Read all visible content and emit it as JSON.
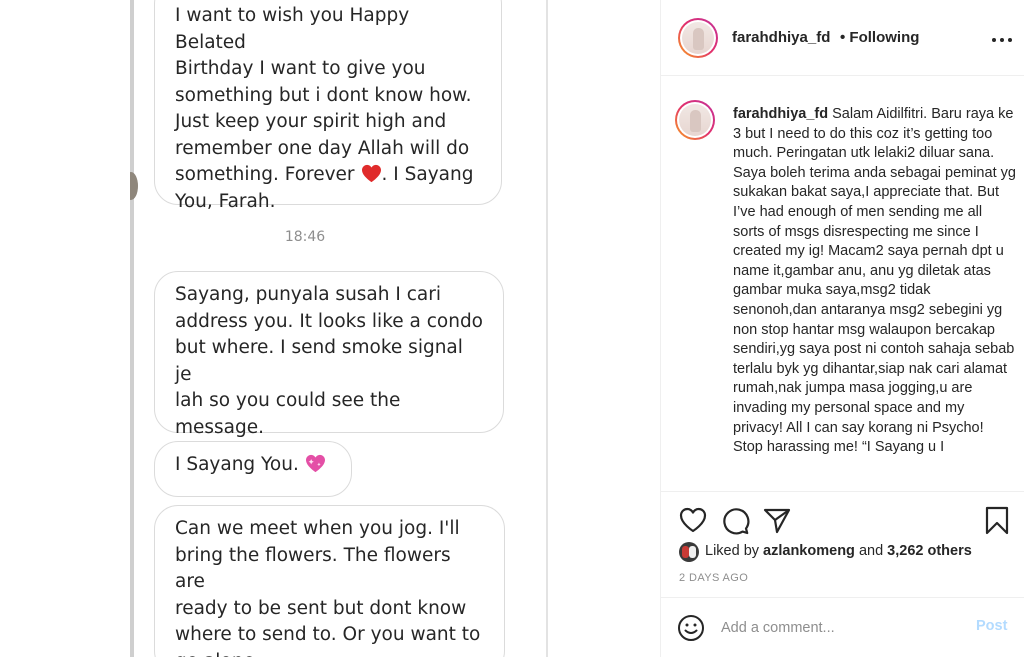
{
  "post_image": {
    "messages": [
      {
        "text": "I want to wish you Happy Belated\nBirthday I want to give you\nsomething but i dont know how.\nJust keep your spirit high and\nremember one day Allah will do\nsomething. Forever",
        "text_after": ". I Sayang\nYou, Farah."
      },
      {
        "text": "Sayang, punyala susah I cari\naddress you. It looks like a condo\nbut where. I send smoke signal je\nlah so you could see the\nmessage."
      },
      {
        "text": "I Sayang You."
      },
      {
        "text": "Can we meet when you jog. I'll\nbring the flowers. The flowers are\nready to be sent but dont know\nwhere to send to. Or you want to\ngo alone."
      }
    ],
    "timestamp": "18:46",
    "emoji": {
      "red_heart": "red-heart-icon",
      "pink_heart": "sparkling-heart-icon"
    },
    "colors": {
      "red_heart": "#e02b2b",
      "pink_heart": "#e44fa6"
    }
  },
  "header": {
    "username": "farahdhiya_fd",
    "follow_status": "• Following"
  },
  "caption": {
    "username": "farahdhiya_fd",
    "text": "Salam Aidilfitri. Baru raya ke 3 but I need to do this coz it’s getting too much. Peringatan utk lelaki2 diluar sana. Saya boleh terima anda sebagai peminat yg sukakan bakat saya,I appreciate that. But I’ve had enough of men sending me all sorts of msgs disrespecting me since I created my ig! Macam2 saya pernah dpt u name it,gambar anu, anu yg diletak atas gambar muka saya,msg2 tidak senonoh,dan antaranya msg2 sebegini yg non stop hantar msg walaupon bercakap sendiri,yg saya post ni contoh sahaja sebab terlalu byk yg dihantar,siap nak cari alamat rumah,nak jumpa masa jogging,u are invading my personal space and my privacy! All I can say korang ni Psycho! Stop harassing me! “I Sayang u I"
  },
  "likes": {
    "prefix": "Liked by",
    "liker": "azlankomeng",
    "joiner": "and",
    "others": "3,262 others"
  },
  "date": "2 DAYS AGO",
  "comment_box": {
    "placeholder": "Add a comment...",
    "post_label": "Post"
  },
  "theme": {
    "text": "#262626",
    "muted": "#8e8e8e",
    "post_disabled": "#b3dbff"
  }
}
